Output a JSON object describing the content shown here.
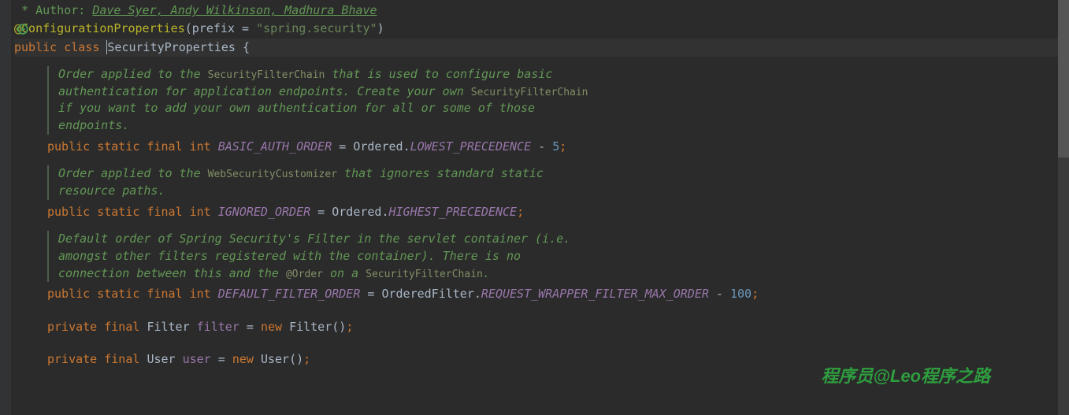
{
  "javadoc_author_prefix": " Author: ",
  "javadoc_authors": "Dave Syer, Andy Wilkinson, Madhura Bhave",
  "annotation": {
    "name": "@ConfigurationProperties",
    "open": "(",
    "param": "prefix",
    "eq": " = ",
    "value": "\"spring.security\"",
    "close": ")"
  },
  "class_decl": {
    "mod": "public class ",
    "name": "SecurityProperties",
    "brace": " {"
  },
  "doc1_a": "Order applied to the ",
  "doc1_code1": "SecurityFilterChain",
  "doc1_b": " that is used to configure basic",
  "doc1_c": "authentication for application endpoints. Create your own ",
  "doc1_code2": "SecurityFilterChain",
  "doc1_d": "if you want to add your own authentication for all or some of those",
  "doc1_e": "endpoints.",
  "const1": {
    "mods": "public static final int ",
    "name": "BASIC_AUTH_ORDER",
    "eq": " = ",
    "owner": "Ordered",
    "dot": ".",
    "ref": "LOWEST_PRECEDENCE",
    "tail_op": " - ",
    "tail_num": "5",
    "semi": ";"
  },
  "doc2_a": "Order applied to the ",
  "doc2_code1": "WebSecurityCustomizer",
  "doc2_b": " that ignores standard static",
  "doc2_c": "resource paths.",
  "const2": {
    "mods": "public static final int ",
    "name": "IGNORED_ORDER",
    "eq": " = ",
    "owner": "Ordered",
    "dot": ".",
    "ref": "HIGHEST_PRECEDENCE",
    "semi": ";"
  },
  "doc3_a": "Default order of Spring Security's Filter in the servlet container (i.e.",
  "doc3_b": "amongst other filters registered with the container). There is no",
  "doc3_c": "connection between this and the ",
  "doc3_code1": "@Order",
  "doc3_d": " on a ",
  "doc3_code2": "SecurityFilterChain",
  "doc3_e": ".",
  "const3": {
    "mods": "public static final int ",
    "name": "DEFAULT_FILTER_ORDER",
    "eq": " = ",
    "owner": "OrderedFilter",
    "dot": ".",
    "ref": "REQUEST_WRAPPER_FILTER_MAX_ORDER",
    "tail_op": " - ",
    "tail_num": "100",
    "semi": ";"
  },
  "field1": {
    "mods": "private final ",
    "type": "Filter ",
    "name": "filter",
    "eq": " = ",
    "newkw": "new ",
    "ctor": "Filter",
    "parens": "()",
    "semi": ";"
  },
  "field2": {
    "mods": "private final ",
    "type": "User ",
    "name": "user",
    "eq": " = ",
    "newkw": "new ",
    "ctor": "User",
    "parens": "()",
    "semi": ";"
  },
  "watermark": "程序员@Leo程序之路"
}
